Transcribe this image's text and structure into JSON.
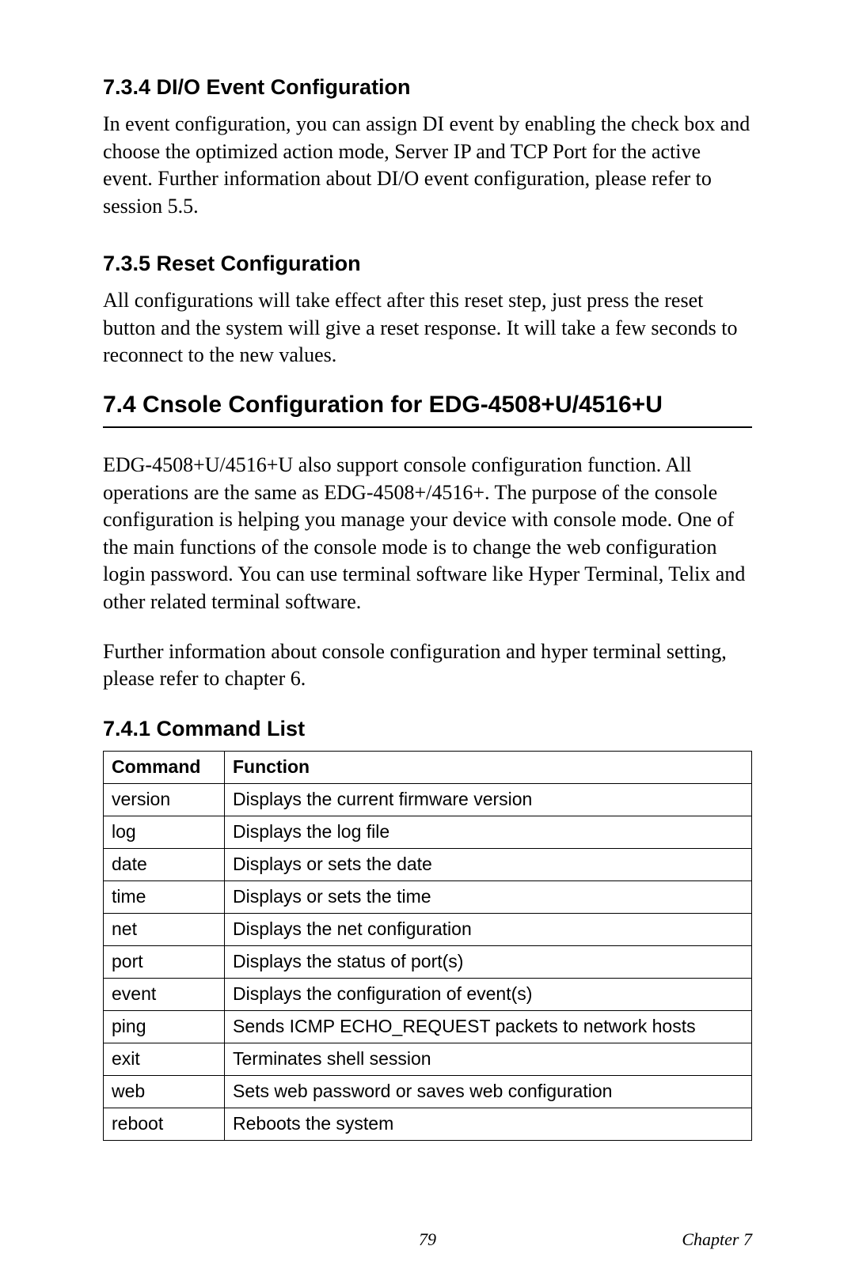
{
  "section_734": {
    "heading": "7.3.4 DI/O Event Configuration",
    "body": "In event configuration, you can assign DI event by enabling the check box and choose the optimized action mode, Server IP and TCP Port for the active event. Further information about DI/O event configuration, please refer to session 5.5."
  },
  "section_735": {
    "heading": "7.3.5 Reset Configuration",
    "body": "All configurations will take effect after this reset step, just press the reset button and the system will give a reset response. It will take a few seconds to reconnect to the new values."
  },
  "section_74": {
    "heading": "7.4  Cnsole Configuration for EDG-4508+U/4516+U",
    "para1": "EDG-4508+U/4516+U also support console configuration function. All operations are the same as EDG-4508+/4516+. The purpose of the console configuration is helping you manage your device with console mode. One of the main functions of the console mode is to change the web configuration login password. You can use terminal software like Hyper Terminal, Telix and other related terminal software.",
    "para2": "Further information about console configuration and hyper terminal setting, please refer to chapter 6."
  },
  "section_741": {
    "heading": "7.4.1 Command List",
    "table": {
      "headers": {
        "command": "Command",
        "function": "Function"
      },
      "rows": [
        {
          "command": "version",
          "function": "Displays the current firmware version"
        },
        {
          "command": "log",
          "function": "Displays the log file"
        },
        {
          "command": "date",
          "function": "Displays or sets the date"
        },
        {
          "command": "time",
          "function": "Displays or sets the time"
        },
        {
          "command": "net",
          "function": "Displays the net configuration"
        },
        {
          "command": "port",
          "function": "Displays the status of port(s)"
        },
        {
          "command": "event",
          "function": "Displays the configuration of event(s)"
        },
        {
          "command": "ping",
          "function": "Sends ICMP ECHO_REQUEST packets to network hosts"
        },
        {
          "command": "exit",
          "function": "Terminates shell session"
        },
        {
          "command": "web",
          "function": "Sets web password or saves web configuration"
        },
        {
          "command": "reboot",
          "function": "Reboots the system"
        }
      ]
    }
  },
  "footer": {
    "page_number": "79",
    "chapter": "Chapter 7"
  }
}
